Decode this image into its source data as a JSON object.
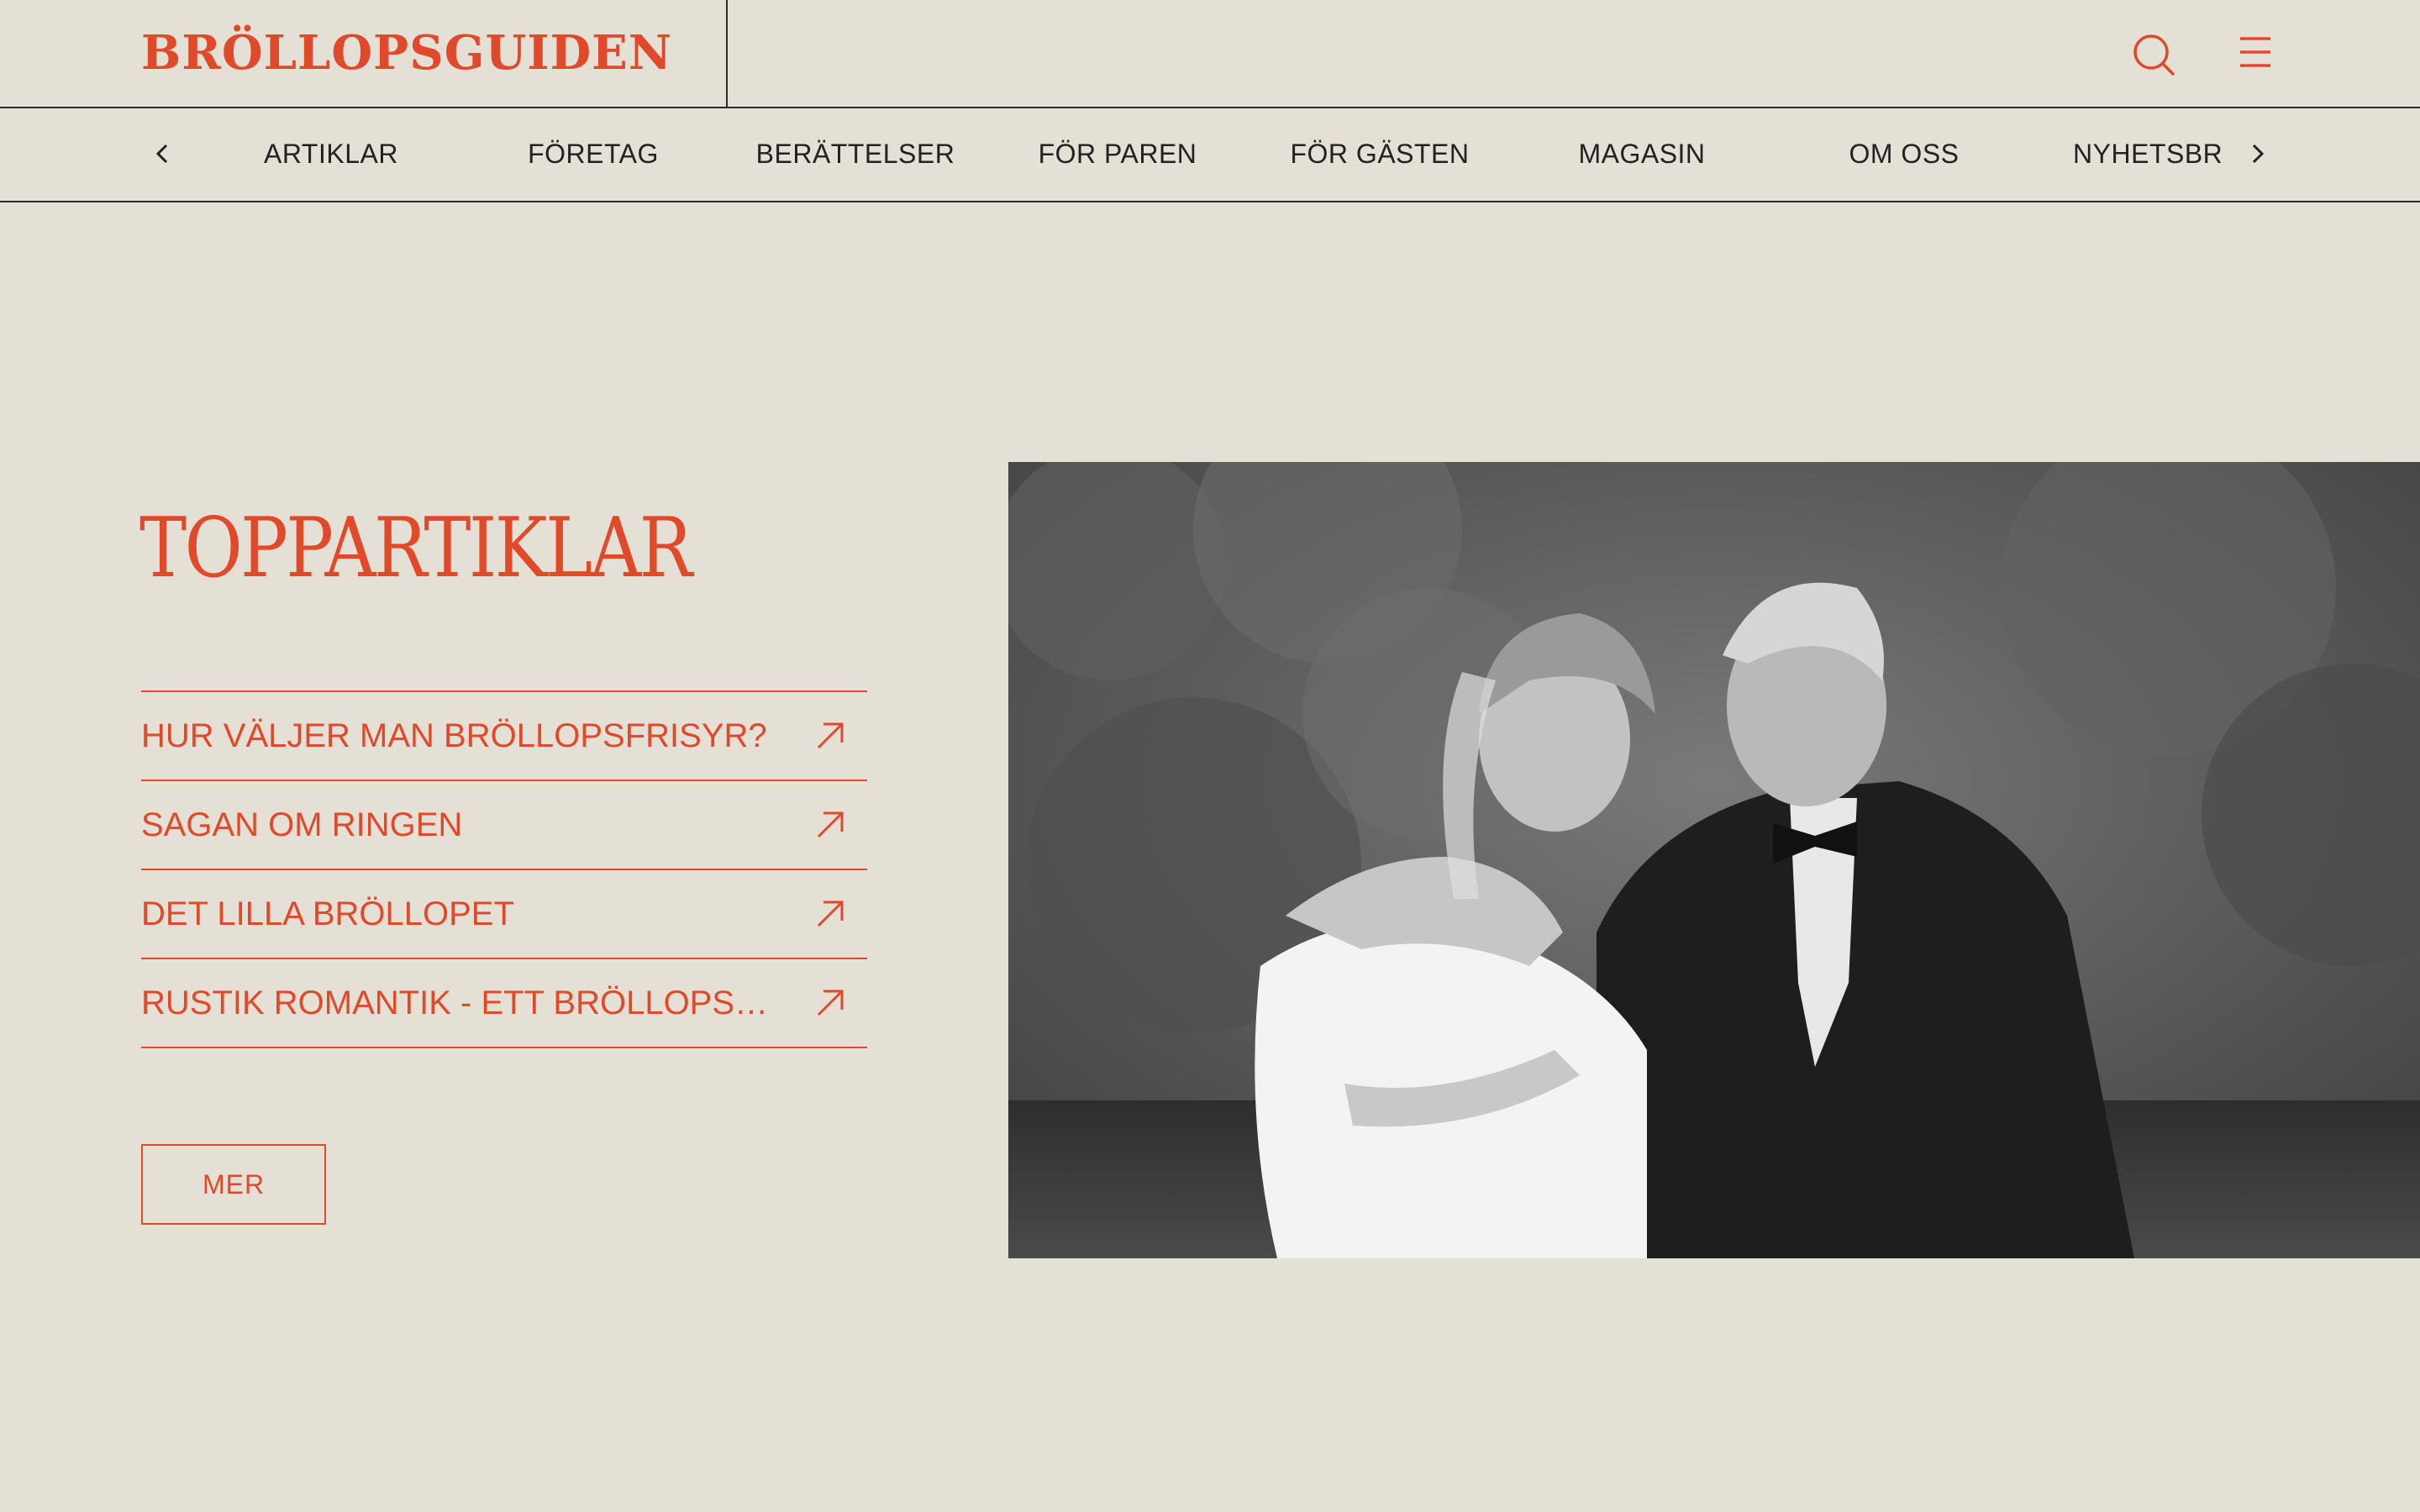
{
  "header": {
    "logo": "BRÖLLOPSGUIDEN",
    "search_icon": "search-icon",
    "menu_icon": "hamburger-menu-icon"
  },
  "nav": {
    "prev_icon": "chevron-left-icon",
    "next_icon": "chevron-right-icon",
    "items": [
      {
        "label": "ARTIKLAR"
      },
      {
        "label": "FÖRETAG"
      },
      {
        "label": "BERÄTTELSER"
      },
      {
        "label": "FÖR PAREN"
      },
      {
        "label": "FÖR GÄSTEN"
      },
      {
        "label": "MAGASIN"
      },
      {
        "label": "OM OSS"
      },
      {
        "label": "NYHETSBREV"
      }
    ]
  },
  "top_articles": {
    "title": "TOPPARTIKLAR",
    "items": [
      {
        "label": "HUR VÄLJER MAN BRÖLLOPSFRISYR?"
      },
      {
        "label": "SAGAN OM RINGEN"
      },
      {
        "label": "DET LILLA BRÖLLOPET"
      },
      {
        "label": "RUSTIK ROMANTIK - ETT BRÖLLOPS…"
      }
    ],
    "more_label": "MER"
  },
  "colors": {
    "accent": "#e04a2a",
    "background": "#e4e0d6",
    "text": "#222222"
  }
}
